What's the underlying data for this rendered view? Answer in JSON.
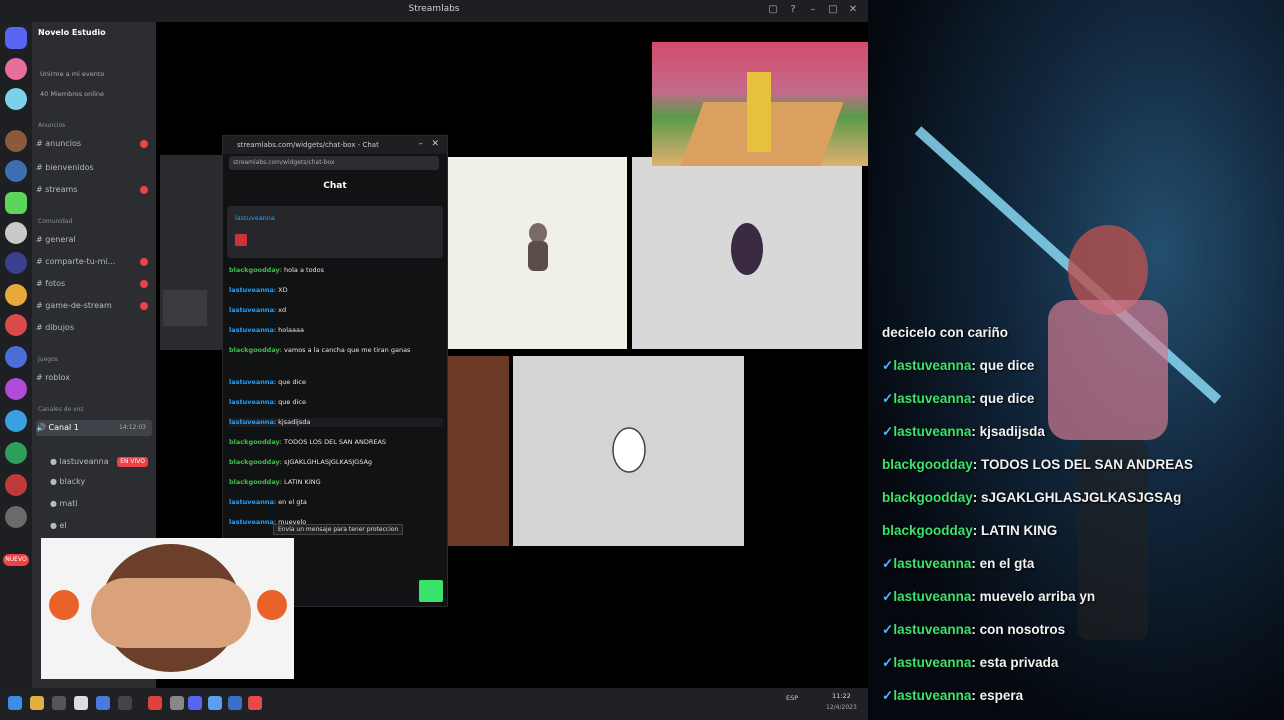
{
  "window": {
    "title": "Streamlabs"
  },
  "server_header": {
    "name": "Novelo Estudio"
  },
  "user_area": {
    "lines": [
      "Unirme a mi evento",
      "40 Miembros online"
    ]
  },
  "sidebar": {
    "categories": [
      "Anuncios",
      "Comunidad",
      "Juegos",
      "Canales de voz"
    ],
    "channels": [
      {
        "label": "anuncios",
        "badge": true
      },
      {
        "label": "bienvenidos",
        "badge": false
      },
      {
        "label": "streams",
        "badge": true
      },
      {
        "label": "general",
        "badge": false
      },
      {
        "label": "comparte-tu-mi...",
        "badge": true
      },
      {
        "label": "fotos",
        "badge": true
      },
      {
        "label": "game-de-stream",
        "badge": true
      },
      {
        "label": "dibujos",
        "badge": false
      },
      {
        "label": "roblox",
        "badge": false
      }
    ],
    "voice_channel": {
      "label": "Canal 1",
      "time": "14:12:03"
    },
    "voice_members": [
      {
        "name": "lastuveanna",
        "live": "EN VIVO"
      },
      {
        "name": "blacky"
      },
      {
        "name": "mati"
      },
      {
        "name": "el"
      }
    ],
    "rail_notification": "NUEVO"
  },
  "popup": {
    "title": "streamlabs.com/widgets/chat-box - Chat",
    "url": "streamlabs.com/widgets/chat-box",
    "chat_label": "Chat",
    "pinned_user": "lastuveanna",
    "messages": [
      {
        "user": "blackgoodday",
        "text": "hola a todos",
        "blue": false
      },
      {
        "user": "lastuveanna",
        "text": "XD",
        "blue": true
      },
      {
        "user": "lastuveanna",
        "text": "xd",
        "blue": true
      },
      {
        "user": "lastuveanna",
        "text": "holaaaa",
        "blue": true
      },
      {
        "user": "blackgoodday",
        "text": "vamos a la cancha que me tiran ganas",
        "blue": false
      },
      {
        "user": "lastuveanna",
        "text": "que dice",
        "blue": true
      },
      {
        "user": "lastuveanna",
        "text": "que dice",
        "blue": true
      },
      {
        "user": "lastuveanna",
        "text": "kjsadijsda",
        "blue": true
      },
      {
        "user": "blackgoodday",
        "text": "TODOS LOS DEL SAN ANDREAS",
        "blue": false
      },
      {
        "user": "blackgoodday",
        "text": "sJGAKLGHLASJGLKASJGSAg",
        "blue": false
      },
      {
        "user": "blackgoodday",
        "text": "LATIN KING",
        "blue": false
      },
      {
        "user": "lastuveanna",
        "text": "en el gta",
        "blue": true
      },
      {
        "user": "lastuveanna",
        "text": "muevelo",
        "blue": true
      }
    ],
    "tooltip": "Envía un mensaje para tener proteccion"
  },
  "overlay_chat": {
    "first_line": "decicelo con cariño",
    "messages": [
      {
        "user": "lastuveanna",
        "text": "que dice"
      },
      {
        "user": "lastuveanna",
        "text": "que dice"
      },
      {
        "user": "lastuveanna",
        "text": "kjsadijsda"
      },
      {
        "user": "blackgoodday",
        "text": "TODOS LOS DEL SAN ANDREAS"
      },
      {
        "user": "blackgoodday",
        "text": "sJGAKLGHLASJGLKASJGSAg"
      },
      {
        "user": "blackgoodday",
        "text": "LATIN KING"
      },
      {
        "user": "lastuveanna",
        "text": "en el gta"
      },
      {
        "user": "lastuveanna",
        "text": "muevelo arriba yn"
      },
      {
        "user": "lastuveanna",
        "text": "con nosotros"
      },
      {
        "user": "lastuveanna",
        "text": "esta privada"
      },
      {
        "user": "lastuveanna",
        "text": "espera"
      }
    ]
  },
  "taskbar": {
    "time": "11:22",
    "date": "12/4/2023",
    "lang": "ESP"
  },
  "colors": {
    "accent_green": "#3ce36a",
    "discord_bg": "#2b2d31",
    "badge_red": "#ed4245"
  }
}
